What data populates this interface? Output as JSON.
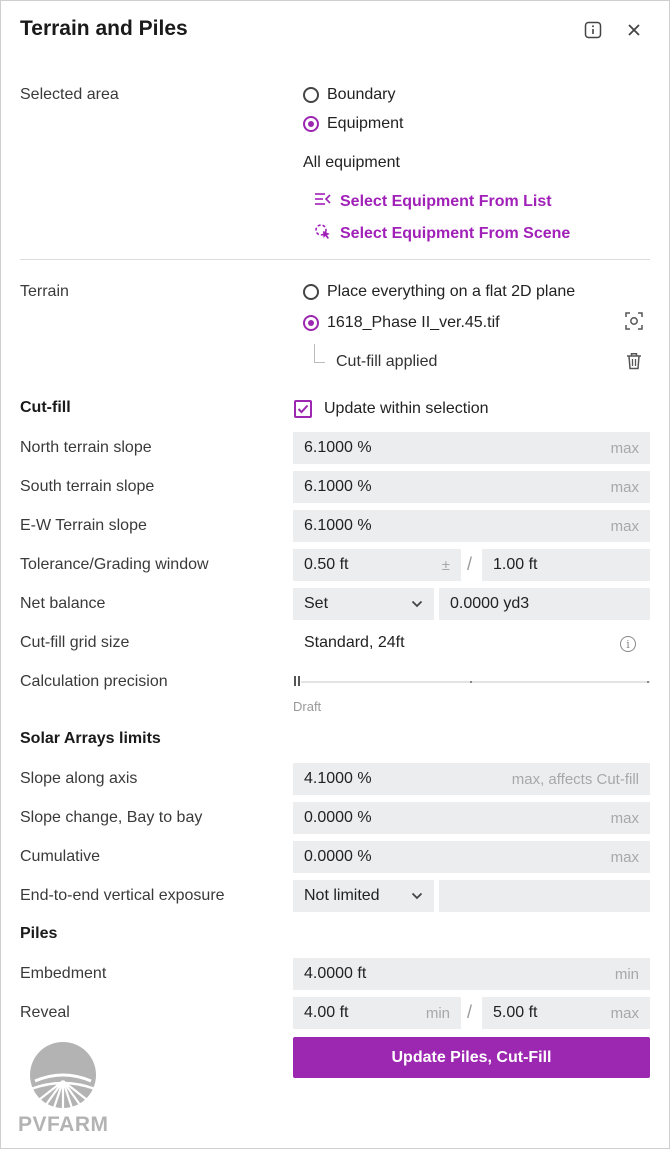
{
  "panel": {
    "title": "Terrain and Piles"
  },
  "selected_area": {
    "label": "Selected area",
    "options": [
      "Boundary",
      "Equipment"
    ],
    "selected": "Equipment",
    "equipment_text": "All equipment",
    "select_from_list": "Select Equipment From List",
    "select_from_scene": "Select Equipment From Scene"
  },
  "terrain": {
    "label": "Terrain",
    "option_flat": "Place everything on a flat 2D plane",
    "option_file": "1618_Phase II_ver.45.tif",
    "selected": "1618_Phase II_ver.45.tif",
    "cutfill_applied": "Cut-fill applied"
  },
  "cutfill": {
    "title": "Cut-fill",
    "update_within_selection": "Update within selection",
    "update_checked": true,
    "north_label": "North terrain slope",
    "north_value": "6.1000 %",
    "north_hint": "max",
    "south_label": "South terrain slope",
    "south_value": "6.1000 %",
    "south_hint": "max",
    "ew_label": "E-W Terrain slope",
    "ew_value": "6.1000 %",
    "ew_hint": "max",
    "tolerance_label": "Tolerance/Grading window",
    "tolerance_value": "0.50 ft",
    "tolerance_sign": "±",
    "window_value": "1.00 ft",
    "net_label": "Net balance",
    "net_select": "Set",
    "net_value": "0.0000 yd3",
    "grid_label": "Cut-fill grid size",
    "grid_value": "Standard, 24ft",
    "precision_label": "Calculation precision",
    "precision_value": "Draft",
    "precision_level": 0
  },
  "solar": {
    "title": "Solar Arrays limits",
    "slope_axis_label": "Slope along axis",
    "slope_axis_value": "4.1000 %",
    "slope_axis_hint": "max, affects Cut-fill",
    "bay_label": "Slope change, Bay to bay",
    "bay_value": "0.0000 %",
    "bay_hint": "max",
    "cumulative_label": "Cumulative",
    "cumulative_value": "0.0000 %",
    "cumulative_hint": "max",
    "exposure_label": "End-to-end vertical exposure",
    "exposure_select": "Not limited"
  },
  "piles": {
    "title": "Piles",
    "embedment_label": "Embedment",
    "embedment_value": "4.0000 ft",
    "embedment_hint": "min",
    "reveal_label": "Reveal",
    "reveal_min_value": "4.00 ft",
    "reveal_min_hint": "min",
    "reveal_max_value": "5.00 ft",
    "reveal_max_hint": "max"
  },
  "actions": {
    "update_button": "Update Piles, Cut-Fill"
  },
  "brand": {
    "logo_text": "PVFARM",
    "accent": "#9c27b0"
  },
  "icons": {
    "info": "info-icon",
    "close": "close-icon",
    "list": "select-list-icon",
    "cursor": "select-cursor-icon",
    "focus": "focus-icon",
    "delete": "trash-icon",
    "dropdown": "chevron-down-icon"
  }
}
